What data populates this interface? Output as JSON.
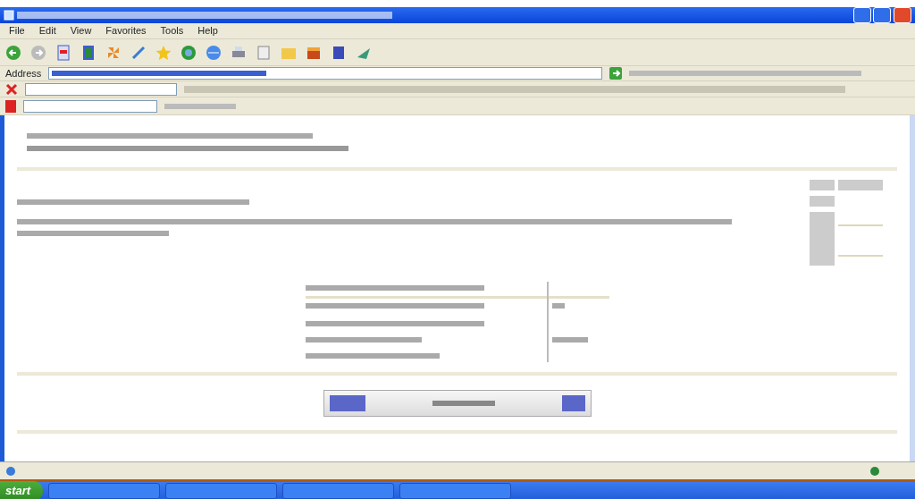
{
  "menu": [
    {
      "label": "File"
    },
    {
      "label": "Edit"
    },
    {
      "label": "View"
    },
    {
      "label": "Favorites"
    },
    {
      "label": "Tools"
    },
    {
      "label": "Help"
    }
  ],
  "address_bar": {
    "label": "Address"
  },
  "taskbar": {
    "start_label": "start"
  }
}
